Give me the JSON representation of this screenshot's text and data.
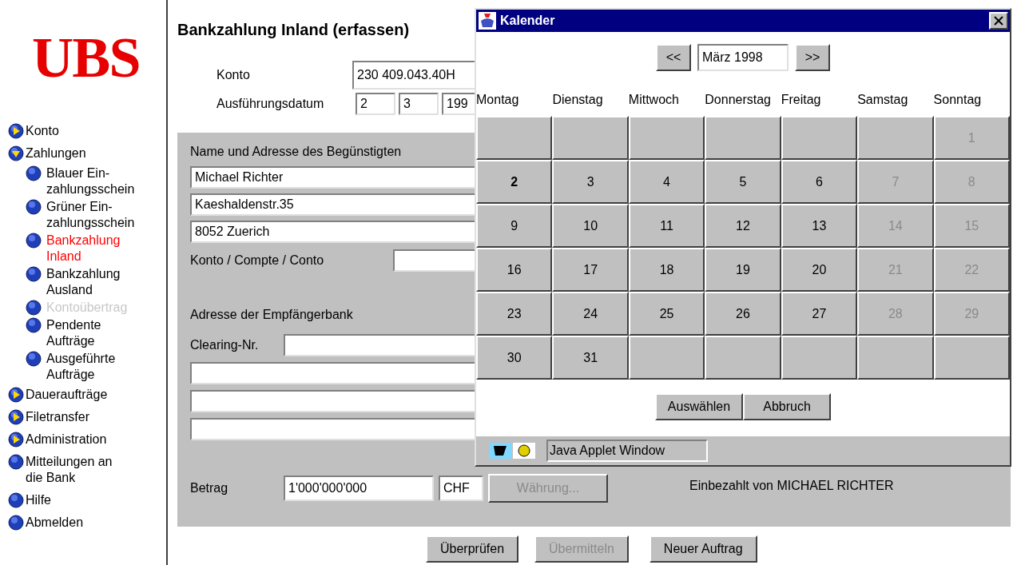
{
  "logo": "UBS",
  "sidebar": {
    "items": [
      {
        "label": "Konto",
        "kind": "group",
        "expanded": false
      },
      {
        "label": "Zahlungen",
        "kind": "group",
        "expanded": true,
        "children": [
          {
            "label": "Blauer Ein-\nzahlungsschein",
            "selected": false,
            "disabled": false
          },
          {
            "label": "Grüner Ein-\nzahlungsschein",
            "selected": false,
            "disabled": false
          },
          {
            "label": "Bankzahlung\nInland",
            "selected": true,
            "disabled": false
          },
          {
            "label": "Bankzahlung\nAusland",
            "selected": false,
            "disabled": false
          },
          {
            "label": "Kontoübertrag",
            "selected": false,
            "disabled": true
          },
          {
            "label": "Pendente\nAufträge",
            "selected": false,
            "disabled": false
          },
          {
            "label": "Ausgeführte\nAufträge",
            "selected": false,
            "disabled": false
          }
        ]
      },
      {
        "label": "Daueraufträge",
        "kind": "group",
        "expanded": false
      },
      {
        "label": "Filetransfer",
        "kind": "group",
        "expanded": false
      },
      {
        "label": "Administration",
        "kind": "group",
        "expanded": false
      },
      {
        "label": "Mitteilungen an\ndie Bank",
        "kind": "leaf"
      },
      {
        "label": "Hilfe",
        "kind": "leaf"
      },
      {
        "label": "Abmelden",
        "kind": "leaf"
      }
    ]
  },
  "form": {
    "title": "Bankzahlung Inland (erfassen)",
    "konto": {
      "label": "Konto",
      "value": "230 409.043.40H"
    },
    "date": {
      "label": "Ausführungsdatum",
      "day": "2",
      "month": "3",
      "year": "199"
    },
    "beneficiary": {
      "heading": "Name und Adresse des Begünstigten",
      "lines": [
        "Michael Richter",
        "Kaeshaldenstr.35",
        "8052 Zuerich"
      ],
      "account_label": "Konto / Compte / Conto"
    },
    "bank": {
      "heading": "Adresse der Empfängerbank",
      "clearing_label": "Clearing-Nr."
    },
    "amount": {
      "label": "Betrag",
      "value": "1'000'000'000",
      "currency": "CHF",
      "currency_button": {
        "label": "Währung...",
        "disabled": true
      },
      "note": "Einbezahlt von MICHAEL RICHTER"
    },
    "buttons": [
      {
        "label": "Überprüfen",
        "disabled": false
      },
      {
        "label": "Übermitteln",
        "disabled": true
      },
      {
        "label": "Neuer Auftrag",
        "disabled": false
      }
    ]
  },
  "calendar": {
    "title": "Kalender",
    "prev": "<<",
    "month": "März 1998",
    "next": ">>",
    "weekdays": [
      "Montag",
      "Dienstag",
      "Mittwoch",
      "Donnerstag",
      "Freitag",
      "Samstag",
      "Sonntag"
    ],
    "weeks": [
      [
        {
          "kind": "blank"
        },
        {
          "kind": "blank"
        },
        {
          "kind": "blank"
        },
        {
          "kind": "blank"
        },
        {
          "kind": "blank"
        },
        {
          "kind": "blank"
        },
        {
          "kind": "day",
          "day": "1",
          "weekend": true,
          "selected": false
        }
      ],
      [
        {
          "day": "2",
          "weekend": false,
          "selected": true
        },
        {
          "day": "3",
          "weekend": false,
          "selected": false
        },
        {
          "day": "4",
          "weekend": false,
          "selected": false
        },
        {
          "day": "5",
          "weekend": false,
          "selected": false
        },
        {
          "day": "6",
          "weekend": false,
          "selected": false
        },
        {
          "day": "7",
          "weekend": true,
          "selected": false
        },
        {
          "day": "8",
          "weekend": true,
          "selected": false
        }
      ],
      [
        {
          "day": "9",
          "weekend": false,
          "selected": false
        },
        {
          "day": "10",
          "weekend": false,
          "selected": false
        },
        {
          "day": "11",
          "weekend": false,
          "selected": false
        },
        {
          "day": "12",
          "weekend": false,
          "selected": false
        },
        {
          "day": "13",
          "weekend": false,
          "selected": false
        },
        {
          "day": "14",
          "weekend": true,
          "selected": false
        },
        {
          "day": "15",
          "weekend": true,
          "selected": false
        }
      ],
      [
        {
          "day": "16",
          "weekend": false,
          "selected": false
        },
        {
          "day": "17",
          "weekend": false,
          "selected": false
        },
        {
          "day": "18",
          "weekend": false,
          "selected": false
        },
        {
          "day": "19",
          "weekend": false,
          "selected": false
        },
        {
          "day": "20",
          "weekend": false,
          "selected": false
        },
        {
          "day": "21",
          "weekend": true,
          "selected": false
        },
        {
          "day": "22",
          "weekend": true,
          "selected": false
        }
      ],
      [
        {
          "day": "23",
          "weekend": false,
          "selected": false
        },
        {
          "day": "24",
          "weekend": false,
          "selected": false
        },
        {
          "day": "25",
          "weekend": false,
          "selected": false
        },
        {
          "day": "26",
          "weekend": false,
          "selected": false
        },
        {
          "day": "27",
          "weekend": false,
          "selected": false
        },
        {
          "day": "28",
          "weekend": true,
          "selected": false
        },
        {
          "day": "29",
          "weekend": true,
          "selected": false
        }
      ],
      [
        {
          "day": "30",
          "weekend": false,
          "selected": false
        },
        {
          "day": "31",
          "weekend": false,
          "selected": false
        },
        {
          "kind": "blank"
        },
        {
          "kind": "blank"
        },
        {
          "kind": "blank"
        },
        {
          "kind": "blank"
        },
        {
          "kind": "blank"
        }
      ]
    ],
    "buttons": [
      "Auswählen",
      "Abbruch"
    ],
    "status": "Java Applet Window"
  }
}
